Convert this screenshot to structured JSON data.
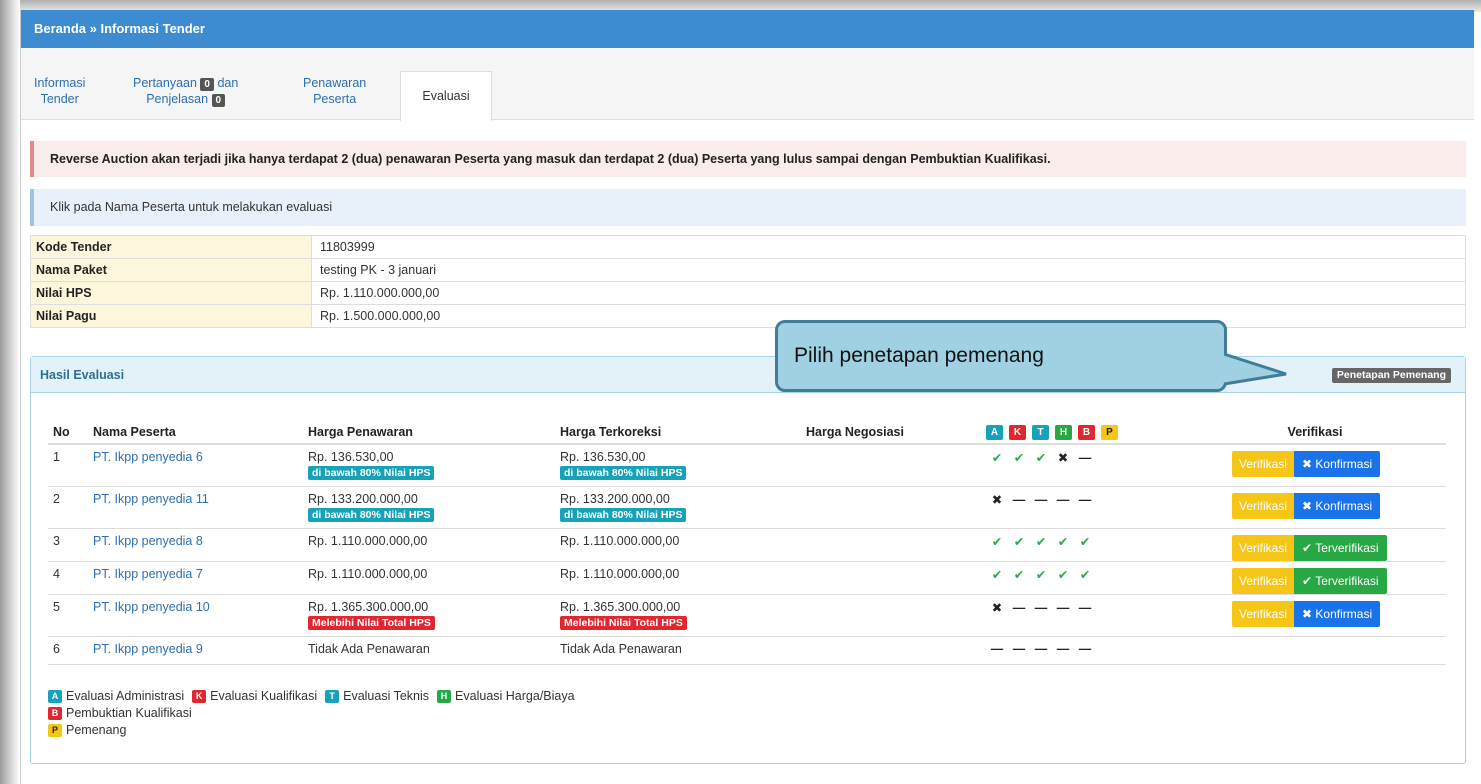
{
  "header": {
    "breadcrumb": "Beranda » Informasi Tender"
  },
  "tabs": [
    {
      "line1": "Informasi",
      "line2": "Tender"
    },
    {
      "line1a": "Pertanyaan",
      "badge1": "0",
      "line1b": "dan",
      "line2": "Penjelasan",
      "badge2": "0"
    },
    {
      "line1": "Penawaran",
      "line2": "Peserta"
    },
    {
      "label": "Evaluasi",
      "active": true
    }
  ],
  "alerts": {
    "danger": "Reverse Auction akan terjadi jika hanya terdapat 2 (dua) penawaran Peserta yang masuk dan terdapat 2 (dua) Peserta yang lulus sampai dengan Pembuktian Kualifikasi.",
    "info": "Klik pada Nama Peserta untuk melakukan evaluasi"
  },
  "tender_info": [
    {
      "key": "Kode Tender",
      "value": "11803999"
    },
    {
      "key": "Nama Paket",
      "value": "testing PK - 3 januari"
    },
    {
      "key": "Nilai HPS",
      "value": "Rp. 1.110.000.000,00"
    },
    {
      "key": "Nilai Pagu",
      "value": "Rp. 1.500.000.000,00"
    }
  ],
  "panel": {
    "title": "Hasil Evaluasi",
    "button": "Penetapan Pemenang"
  },
  "callout": "Pilih penetapan pemenang",
  "table": {
    "headers": {
      "no": "No",
      "nama": "Nama Peserta",
      "harga_penawaran": "Harga Penawaran",
      "harga_terkoreksi": "Harga Terkoreksi",
      "harga_negosiasi": "Harga Negosiasi",
      "verifikasi": "Verifikasi"
    },
    "stage_badges": [
      "A",
      "K",
      "T",
      "H",
      "B",
      "P"
    ],
    "rows": [
      {
        "no": "1",
        "nama": "PT. Ikpp penyedia 6",
        "penawaran": "Rp. 136.530,00",
        "terkoreksi": "Rp. 136.530,00",
        "label": "di bawah 80% Nilai HPS",
        "label_type": "info",
        "marks": [
          "ok",
          "ok",
          "ok",
          "x",
          "dash"
        ],
        "ver": "Verifikasi",
        "status": "Konfirmasi",
        "status_type": "konf"
      },
      {
        "no": "2",
        "nama": "PT. Ikpp penyedia 11",
        "penawaran": "Rp. 133.200.000,00",
        "terkoreksi": "Rp. 133.200.000,00",
        "label": "di bawah 80% Nilai HPS",
        "label_type": "info",
        "marks": [
          "x",
          "dash",
          "dash",
          "dash",
          "dash"
        ],
        "ver": "Verifikasi",
        "status": "Konfirmasi",
        "status_type": "konf"
      },
      {
        "no": "3",
        "nama": "PT. Ikpp penyedia 8",
        "penawaran": "Rp. 1.110.000.000,00",
        "terkoreksi": "Rp. 1.110.000.000,00",
        "label": "",
        "label_type": "",
        "marks": [
          "ok",
          "ok",
          "ok",
          "ok",
          "ok"
        ],
        "ver": "Verifikasi",
        "status": "Terverifikasi",
        "status_type": "terv"
      },
      {
        "no": "4",
        "nama": "PT. Ikpp penyedia 7",
        "penawaran": "Rp. 1.110.000.000,00",
        "terkoreksi": "Rp. 1.110.000.000,00",
        "label": "",
        "label_type": "",
        "marks": [
          "ok",
          "ok",
          "ok",
          "ok",
          "ok"
        ],
        "ver": "Verifikasi",
        "status": "Terverifikasi",
        "status_type": "terv"
      },
      {
        "no": "5",
        "nama": "PT. Ikpp penyedia 10",
        "penawaran": "Rp. 1.365.300.000,00",
        "terkoreksi": "Rp. 1.365.300.000,00",
        "label": "Melebihi Nilai Total HPS",
        "label_type": "danger",
        "marks": [
          "x",
          "dash",
          "dash",
          "dash",
          "dash"
        ],
        "ver": "Verifikasi",
        "status": "Konfirmasi",
        "status_type": "konf"
      },
      {
        "no": "6",
        "nama": "PT. Ikpp penyedia 9",
        "penawaran": "Tidak Ada Penawaran",
        "terkoreksi": "Tidak Ada Penawaran",
        "label": "",
        "label_type": "",
        "marks": [
          "dash",
          "dash",
          "dash",
          "dash",
          "dash"
        ],
        "ver": "",
        "status": "",
        "status_type": ""
      }
    ]
  },
  "legend": [
    {
      "badge": "A",
      "text": "Evaluasi Administrasi"
    },
    {
      "badge": "K",
      "text": "Evaluasi Kualifikasi"
    },
    {
      "badge": "T",
      "text": "Evaluasi Teknis"
    },
    {
      "badge": "H",
      "text": "Evaluasi Harga/Biaya"
    },
    {
      "badge": "B",
      "text": "Pembuktian Kualifikasi"
    },
    {
      "badge": "P",
      "text": "Pemenang"
    }
  ],
  "colors": {
    "header_bg": "#3d8bd1",
    "link": "#2c6fb3",
    "check_green": "#2ea84c",
    "verifikasi_yellow": "#f5c518",
    "konfirmasi_blue": "#1a73e8",
    "terverifikasi_green": "#28a745"
  }
}
